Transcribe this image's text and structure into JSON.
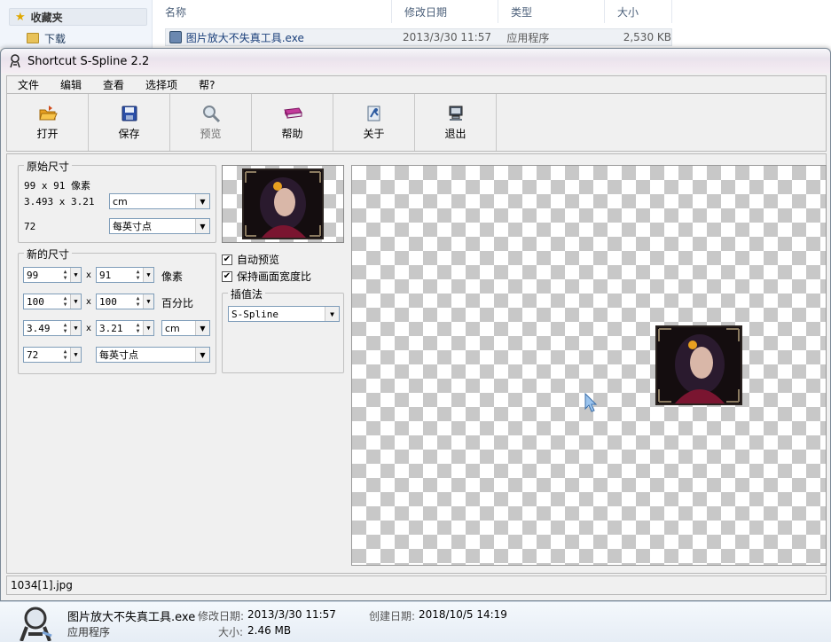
{
  "explorer": {
    "favorites_label": "收藏夹",
    "downloads_label": "下载",
    "columns": [
      "名称",
      "修改日期",
      "类型",
      "大小"
    ],
    "file": {
      "name": "图片放大不失真工具.exe",
      "date": "2013/3/30 11:57",
      "type": "应用程序",
      "size": "2,530 KB"
    }
  },
  "window": {
    "title": "Shortcut S-Spline 2.2",
    "menu": [
      "文件",
      "编辑",
      "查看",
      "选择项",
      "帮?"
    ],
    "toolbar": [
      {
        "label": "打开",
        "icon": "open-folder-icon",
        "enabled": true
      },
      {
        "label": "保存",
        "icon": "save-disk-icon",
        "enabled": true
      },
      {
        "label": "预览",
        "icon": "magnifier-icon",
        "enabled": false
      },
      {
        "label": "帮助",
        "icon": "help-book-icon",
        "enabled": true
      },
      {
        "label": "关于",
        "icon": "about-icon",
        "enabled": true
      },
      {
        "label": "退出",
        "icon": "exit-computer-icon",
        "enabled": true
      }
    ]
  },
  "original": {
    "legend": "原始尺寸",
    "pixels_text": "99 x 91 像素",
    "size_text": "3.493 x 3.21",
    "unit": "cm",
    "dpi": "72",
    "dpi_unit": "每英寸点"
  },
  "new_size": {
    "legend": "新的尺寸",
    "sep": "x",
    "width_px": "99",
    "height_px": "91",
    "px_unit": "像素",
    "width_pct": "100",
    "height_pct": "100",
    "pct_unit": "百分比",
    "width_cm": "3.49",
    "height_cm": "3.21",
    "unit": "cm",
    "dpi": "72",
    "dpi_unit": "每英寸点"
  },
  "options": {
    "auto_preview": "自动预览",
    "auto_preview_checked": true,
    "keep_ratio": "保持画面宽度比",
    "keep_ratio_checked": true,
    "interp_legend": "插值法",
    "interp_value": "S-Spline"
  },
  "status": {
    "filename": "1034[1].jpg"
  },
  "details": {
    "name": "图片放大不失真工具.exe",
    "type": "应用程序",
    "mod_label": "修改日期:",
    "mod_value": "2013/3/30 11:57",
    "created_label": "创建日期:",
    "created_value": "2018/10/5 14:19",
    "size_label": "大小:",
    "size_value": "2.46 MB"
  },
  "colors": {
    "accent": "#1e395b",
    "title_gradient": "#efe6ef",
    "checker": "#c8c8c8"
  }
}
